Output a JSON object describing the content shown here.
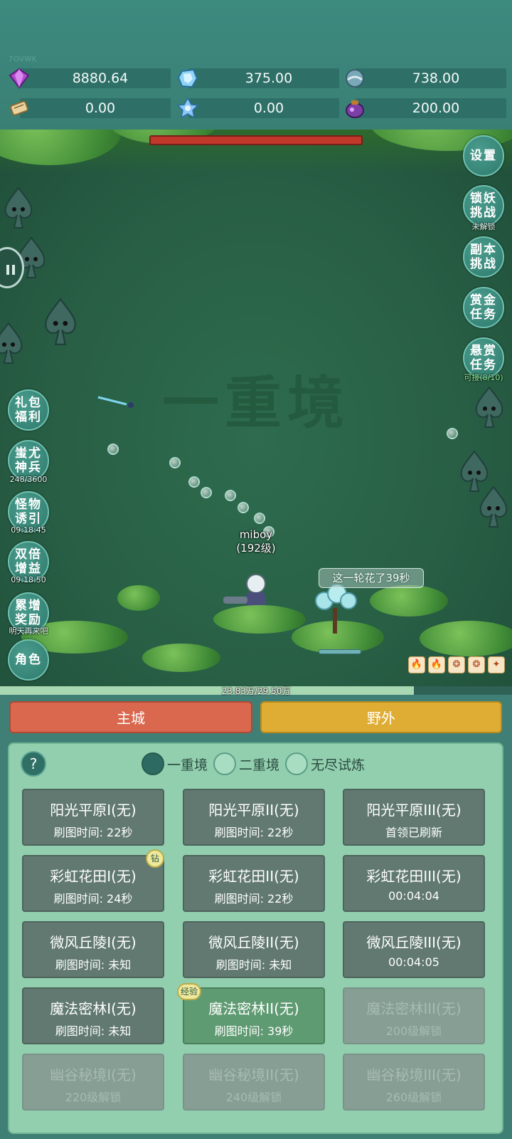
{
  "watermark_code": "7OVWK",
  "resources": [
    {
      "icon": "purple-gem-icon",
      "value": "8880.64"
    },
    {
      "icon": "blue-crystal-icon",
      "value": "375.00"
    },
    {
      "icon": "stone-orb-icon",
      "value": "738.00"
    },
    {
      "icon": "scroll-icon",
      "value": "0.00"
    },
    {
      "icon": "ice-crystal-icon",
      "value": "0.00"
    },
    {
      "icon": "purple-pouch-icon",
      "value": "200.00"
    }
  ],
  "scene": {
    "stage_watermark": "一重境",
    "player_name": "miboy",
    "player_level": "(192级)",
    "timer_text": "这一轮花了39秒",
    "exp_text": "23.83万/29.50万",
    "exp_fraction": 0.808
  },
  "right_buttons": [
    {
      "key": "settings",
      "label": "设置",
      "sub": ""
    },
    {
      "key": "lock-demon",
      "label": "锁妖挑战",
      "sub": "未解锁"
    },
    {
      "key": "dungeon",
      "label": "副本挑战",
      "sub": ""
    },
    {
      "key": "gold-quest",
      "label": "赏金任务",
      "sub": ""
    },
    {
      "key": "bounty-quest",
      "label": "悬赏任务",
      "sub": "可接(8/10)"
    }
  ],
  "left_buttons": [
    {
      "key": "gift-pack",
      "label": "礼包福利",
      "sub": ""
    },
    {
      "key": "chiyou-weapon",
      "label": "蚩尤神兵",
      "sub": "248/3600"
    },
    {
      "key": "monster-lure",
      "label": "怪物诱引",
      "sub": "09:18:45"
    },
    {
      "key": "double-bonus",
      "label": "双倍增益",
      "sub": "09:18:50"
    },
    {
      "key": "cumulative-reward",
      "label": "累增奖励",
      "sub": "明天再来吧"
    },
    {
      "key": "character",
      "label": "角色",
      "sub": ""
    }
  ],
  "buffs": [
    "🔥",
    "🔥",
    "❂",
    "❂",
    "✦"
  ],
  "tabs": {
    "main_city": "主城",
    "wild": "野外"
  },
  "help_label": "?",
  "modes": [
    {
      "label": "一重境",
      "selected": true
    },
    {
      "label": "二重境",
      "selected": false
    },
    {
      "label": "无尽试炼",
      "selected": false
    }
  ],
  "maps": [
    {
      "name": "阳光平原I(无)",
      "sub": "刷图时间: 22秒",
      "state": "normal",
      "badge": ""
    },
    {
      "name": "阳光平原II(无)",
      "sub": "刷图时间: 22秒",
      "state": "normal",
      "badge": ""
    },
    {
      "name": "阳光平原III(无)",
      "sub": "首领已刷新",
      "state": "normal",
      "badge": ""
    },
    {
      "name": "彩虹花田I(无)",
      "sub": "刷图时间: 24秒",
      "state": "normal",
      "badge": "钻"
    },
    {
      "name": "彩虹花田II(无)",
      "sub": "刷图时间: 22秒",
      "state": "normal",
      "badge": ""
    },
    {
      "name": "彩虹花田III(无)",
      "sub": "00:04:04",
      "state": "normal",
      "badge": ""
    },
    {
      "name": "微风丘陵I(无)",
      "sub": "刷图时间: 未知",
      "state": "normal",
      "badge": ""
    },
    {
      "name": "微风丘陵II(无)",
      "sub": "刷图时间: 未知",
      "state": "normal",
      "badge": ""
    },
    {
      "name": "微风丘陵III(无)",
      "sub": "00:04:05",
      "state": "normal",
      "badge": ""
    },
    {
      "name": "魔法密林I(无)",
      "sub": "刷图时间: 未知",
      "state": "normal",
      "badge": ""
    },
    {
      "name": "魔法密林II(无)",
      "sub": "刷图时间: 39秒",
      "state": "active",
      "badge": "经验"
    },
    {
      "name": "魔法密林III(无)",
      "sub": "200级解锁",
      "state": "locked",
      "badge": ""
    },
    {
      "name": "幽谷秘境I(无)",
      "sub": "220级解锁",
      "state": "locked",
      "badge": ""
    },
    {
      "name": "幽谷秘境II(无)",
      "sub": "240级解锁",
      "state": "locked",
      "badge": ""
    },
    {
      "name": "幽谷秘境III(无)",
      "sub": "260级解锁",
      "state": "locked",
      "badge": ""
    }
  ]
}
